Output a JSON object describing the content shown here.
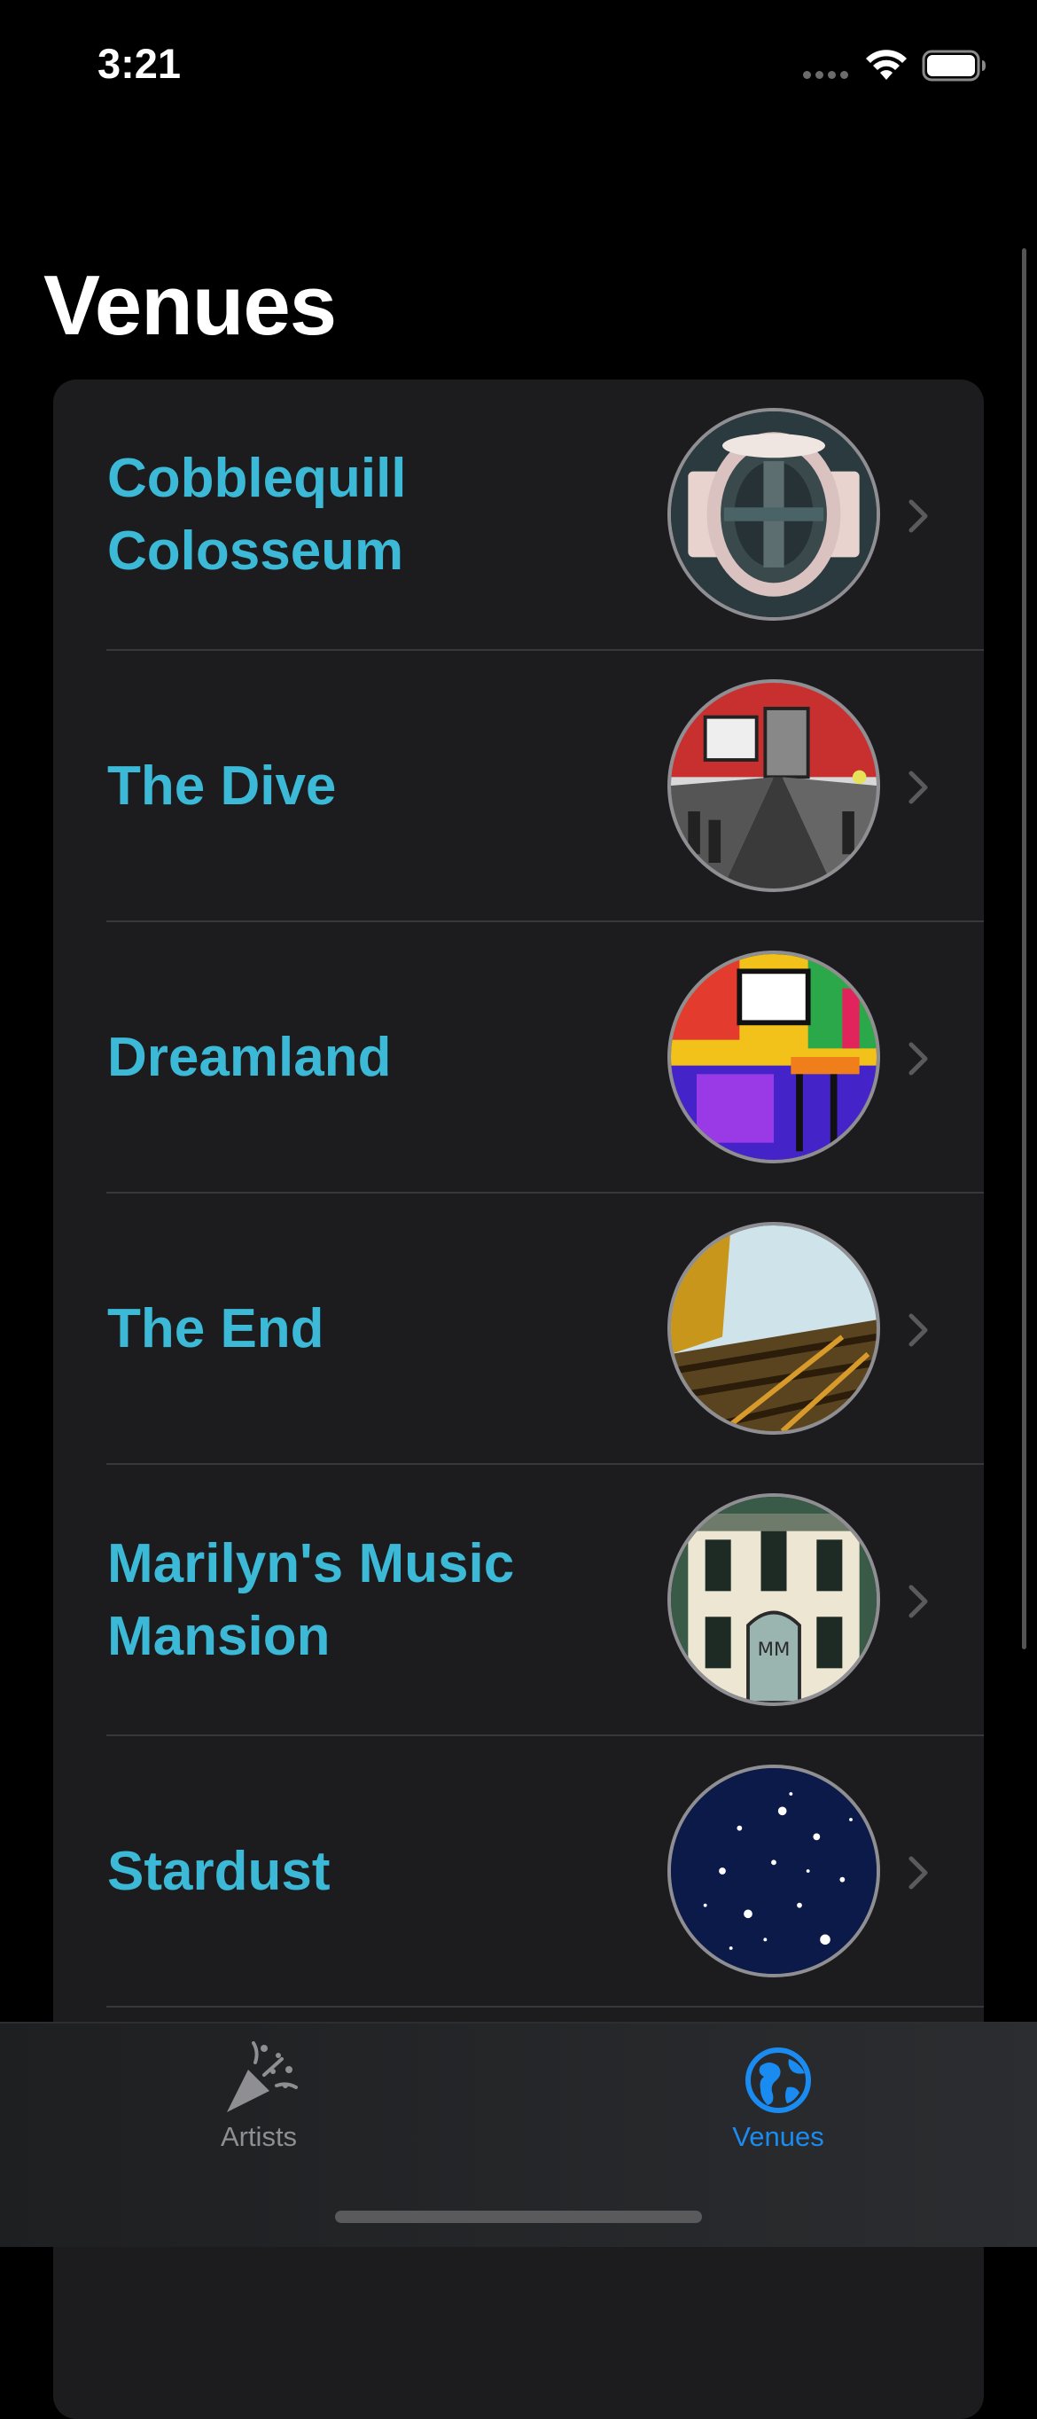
{
  "status_bar": {
    "time": "3:21"
  },
  "page": {
    "title": "Venues"
  },
  "venues": [
    {
      "name": "Cobblequill Colosseum",
      "thumbnail": "stadium-aerial"
    },
    {
      "name": "The Dive",
      "thumbnail": "bar-interior-sketch"
    },
    {
      "name": "Dreamland",
      "thumbnail": "colorful-bar-painting"
    },
    {
      "name": "The End",
      "thumbnail": "railroad-tracks-painting"
    },
    {
      "name": "Marilyn's Music Mansion",
      "thumbnail": "mansion-facade"
    },
    {
      "name": "Stardust",
      "thumbnail": "starry-sky"
    }
  ],
  "tab_bar": {
    "tabs": [
      {
        "label": "Artists",
        "icon": "party-popper-icon",
        "selected": false
      },
      {
        "label": "Venues",
        "icon": "globe-icon",
        "selected": true
      }
    ]
  },
  "colors": {
    "accent": "#1a8bf0",
    "venue_name": "#3bb9d6",
    "card_bg": "#1c1c1e",
    "inactive_tab": "#8e8e93"
  }
}
